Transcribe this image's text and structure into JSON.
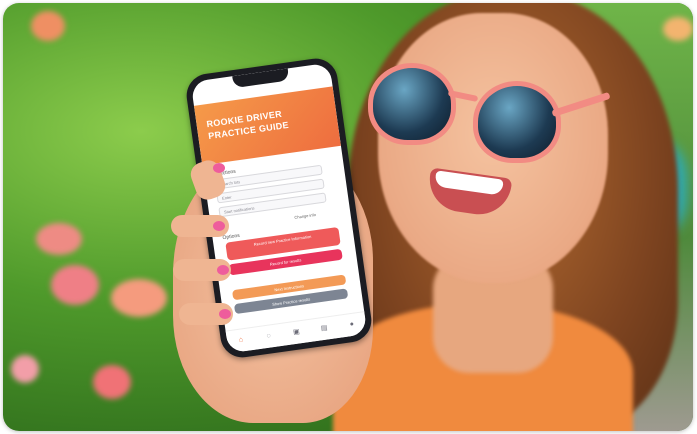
{
  "app": {
    "title": "ROOKIE DRIVER PRACTICE GUIDE",
    "section_label": "Directions",
    "fields": [
      {
        "placeholder": "Search lots"
      },
      {
        "placeholder": "Enter"
      },
      {
        "placeholder": "Start notifications"
      }
    ],
    "link_text": "Change info",
    "options_label": "Options",
    "buttons": [
      {
        "label": "Record new Practice Information",
        "color": "#ef5a5a"
      },
      {
        "label": "Record for results",
        "color": "#e8345c"
      },
      {
        "label": "Next Instructions",
        "color": "#f39a56"
      },
      {
        "label": "Show Practice results",
        "color": "#7d8593"
      }
    ],
    "tabs": [
      {
        "icon": "home-icon",
        "glyph": "⌂"
      },
      {
        "icon": "car-icon",
        "glyph": "◌"
      },
      {
        "icon": "guide-icon",
        "glyph": "▣"
      },
      {
        "icon": "calendar-icon",
        "glyph": "▤"
      },
      {
        "icon": "profile-icon",
        "glyph": "●"
      }
    ]
  },
  "colors": {
    "banner_start": "#f59a49",
    "banner_end": "#ee6d3f",
    "sunglasses_frame": "#f28b83",
    "nail_polish": "#ee5d9c",
    "shirt": "#f08a3e"
  }
}
